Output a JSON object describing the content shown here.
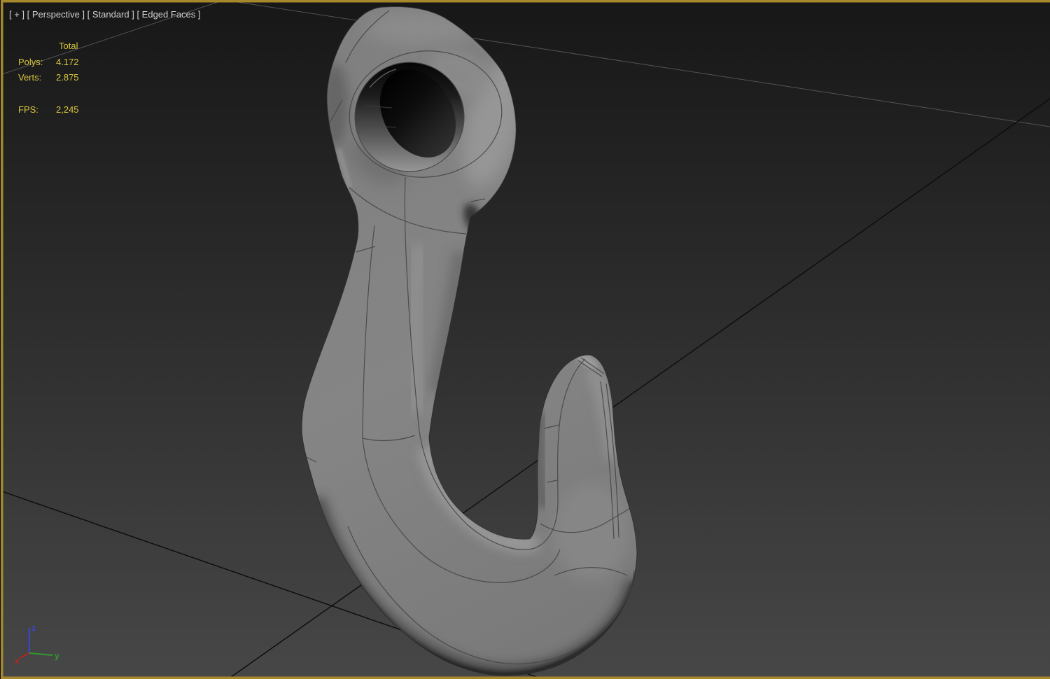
{
  "viewport": {
    "label": "[ + ] [ Perspective ] [ Standard ] [ Edged Faces ]",
    "view_name": "Perspective",
    "shading_mode": "Standard",
    "display_mode": "Edged Faces"
  },
  "stats": {
    "header": "Total",
    "polys_label": "Polys:",
    "polys_value": "4.172",
    "verts_label": "Verts:",
    "verts_value": "2.875",
    "fps_label": "FPS:",
    "fps_value": "2,245"
  },
  "axis_gizmo": {
    "x_label": "x",
    "y_label": "y",
    "z_label": "z"
  },
  "colors": {
    "border": "#a6882c",
    "label_text": "#d2d2d2",
    "stats_text": "#d9c63e",
    "axis_x": "#b32626",
    "axis_y": "#2f9a2f",
    "axis_z": "#3b46d8",
    "grid_light": "#6a6a6a",
    "grid_dark": "#0c0c0c",
    "model_gray": "#828282"
  }
}
